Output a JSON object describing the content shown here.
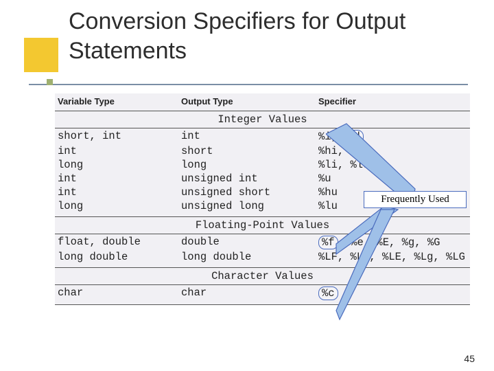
{
  "title": "Conversion Specifiers for Output Statements",
  "headers": {
    "col1": "Variable Type",
    "col2": "Output Type",
    "col3": "Specifier"
  },
  "sections": {
    "integer": "Integer Values",
    "float": "Floating-Point Values",
    "char": "Character Values"
  },
  "integer_rows": [
    {
      "vtype": "short, int",
      "otype": "int",
      "pre": "%i, ",
      "hl": "%d",
      "post": ""
    },
    {
      "vtype": "int",
      "otype": "short",
      "pre": "%hi, %hd",
      "hl": "",
      "post": ""
    },
    {
      "vtype": "long",
      "otype": "long",
      "pre": "%li, %ld",
      "hl": "",
      "post": ""
    },
    {
      "vtype": "int",
      "otype": "unsigned int",
      "pre": "%u",
      "hl": "",
      "post": ""
    },
    {
      "vtype": "int",
      "otype": "unsigned short",
      "pre": "%hu",
      "hl": "",
      "post": ""
    },
    {
      "vtype": "long",
      "otype": "unsigned long",
      "pre": "%lu",
      "hl": "",
      "post": ""
    }
  ],
  "float_rows": [
    {
      "vtype": "float, double",
      "otype": "double",
      "pre": "",
      "hl": "%f",
      "post": ", %e, %E, %g, %G"
    },
    {
      "vtype": "long double",
      "otype": "long double",
      "pre": "%LF, %Le, %LE, %Lg, %LG",
      "hl": "",
      "post": ""
    }
  ],
  "char_rows": [
    {
      "vtype": "char",
      "otype": "char",
      "pre": "",
      "hl": "%c",
      "post": ""
    }
  ],
  "callout": "Frequently Used",
  "page": "45"
}
